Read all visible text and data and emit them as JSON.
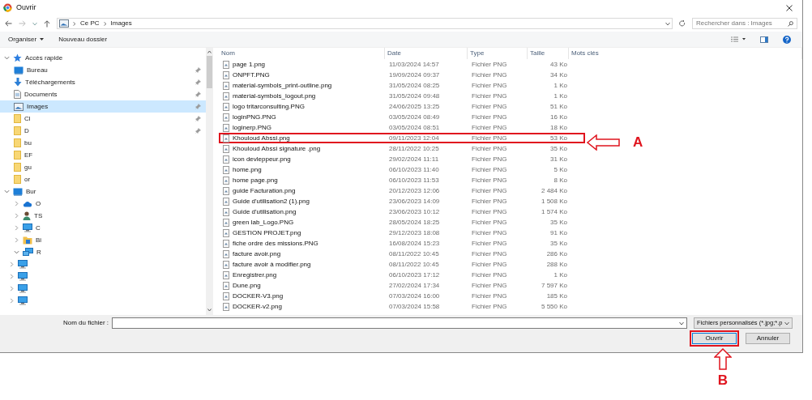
{
  "window": {
    "title": "Ouvrir"
  },
  "address": {
    "path": [
      "Ce PC",
      "Images"
    ],
    "search_placeholder": "Rechercher dans : Images"
  },
  "toolbar": {
    "organize": "Organiser",
    "new_folder": "Nouveau dossier"
  },
  "sidebar": {
    "items": [
      {
        "label": "Accès rapide",
        "kind": "star",
        "expanded": true,
        "selected": false,
        "children": [
          {
            "label": "Bureau",
            "kind": "desktop",
            "pinned": true,
            "selected": false
          },
          {
            "label": "Téléchargements",
            "kind": "download",
            "pinned": true,
            "selected": false
          },
          {
            "label": "Documents",
            "kind": "document",
            "pinned": true,
            "selected": false
          },
          {
            "label": "Images",
            "kind": "pictures",
            "pinned": true,
            "selected": true
          },
          {
            "label": "Cl",
            "kind": "folder",
            "pinned": true,
            "selected": false
          },
          {
            "label": "D",
            "kind": "folder",
            "pinned": true,
            "selected": false
          },
          {
            "label": "bu",
            "kind": "folder",
            "pinned": false,
            "selected": false
          },
          {
            "label": "EF",
            "kind": "folder",
            "pinned": false,
            "selected": false
          },
          {
            "label": "gu",
            "kind": "folder",
            "pinned": false,
            "selected": false
          },
          {
            "label": "or",
            "kind": "folder",
            "pinned": false,
            "selected": false
          }
        ]
      },
      {
        "label": "Bur",
        "kind": "desktop",
        "expanded": true,
        "selected": false,
        "children": [
          {
            "label": "O",
            "kind": "cloud",
            "expanded": false,
            "selected": false
          },
          {
            "label": "TS",
            "kind": "user",
            "expanded": false,
            "selected": false
          },
          {
            "label": "C",
            "kind": "computer",
            "expanded": false,
            "selected": false
          },
          {
            "label": "Bi",
            "kind": "library",
            "expanded": false,
            "selected": false
          },
          {
            "label": "R",
            "kind": "network",
            "expanded": true,
            "selected": false,
            "children": [
              {
                "kind": "computer",
                "expanded": false,
                "selected": false
              },
              {
                "kind": "computer",
                "expanded": false,
                "selected": false
              },
              {
                "kind": "computer",
                "expanded": false,
                "selected": false
              },
              {
                "kind": "computer",
                "expanded": false,
                "selected": false
              }
            ]
          }
        ]
      }
    ]
  },
  "table": {
    "columns": [
      "Nom",
      "Date",
      "Type",
      "Taille",
      "Mots clés"
    ],
    "rows": [
      {
        "name": "page 1.png",
        "date": "11/03/2024 14:57",
        "type": "Fichier PNG",
        "size": "43 Ko",
        "annotated": false
      },
      {
        "name": "ONPFT.PNG",
        "date": "19/09/2024 09:37",
        "type": "Fichier PNG",
        "size": "34 Ko",
        "annotated": false
      },
      {
        "name": "material-symbols_print-outline.png",
        "date": "31/05/2024 08:25",
        "type": "Fichier PNG",
        "size": "1 Ko",
        "annotated": false
      },
      {
        "name": "material-symbols_logout.png",
        "date": "31/05/2024 09:48",
        "type": "Fichier PNG",
        "size": "1 Ko",
        "annotated": false
      },
      {
        "name": "logo tritarconsulting.PNG",
        "date": "24/06/2025 13:25",
        "type": "Fichier PNG",
        "size": "51 Ko",
        "annotated": false
      },
      {
        "name": "loginPNG.PNG",
        "date": "03/05/2024 08:49",
        "type": "Fichier PNG",
        "size": "16 Ko",
        "annotated": false
      },
      {
        "name": "loginerp.PNG",
        "date": "03/05/2024 08:51",
        "type": "Fichier PNG",
        "size": "18 Ko",
        "annotated": false
      },
      {
        "name": "Khouloud Abssi.png",
        "date": "09/11/2023 12:04",
        "type": "Fichier PNG",
        "size": "53 Ko",
        "annotated": true
      },
      {
        "name": "Khouloud Abssi signature .png",
        "date": "28/11/2022 10:25",
        "type": "Fichier PNG",
        "size": "35 Ko",
        "annotated": false
      },
      {
        "name": "icon devleppeur.png",
        "date": "29/02/2024 11:11",
        "type": "Fichier PNG",
        "size": "31 Ko",
        "annotated": false
      },
      {
        "name": "home.png",
        "date": "06/10/2023 11:40",
        "type": "Fichier PNG",
        "size": "5 Ko",
        "annotated": false
      },
      {
        "name": "home page.png",
        "date": "06/10/2023 11:53",
        "type": "Fichier PNG",
        "size": "8 Ko",
        "annotated": false
      },
      {
        "name": "guide Facturation.png",
        "date": "20/12/2023 12:06",
        "type": "Fichier PNG",
        "size": "2 484 Ko",
        "annotated": false
      },
      {
        "name": "Guide d'utilisation2 (1).png",
        "date": "23/06/2023 14:09",
        "type": "Fichier PNG",
        "size": "1 508 Ko",
        "annotated": false
      },
      {
        "name": "Guide d'utilisation.png",
        "date": "23/06/2023 10:12",
        "type": "Fichier PNG",
        "size": "1 574 Ko",
        "annotated": false
      },
      {
        "name": "green lab_Logo.PNG",
        "date": "28/05/2024 18:25",
        "type": "Fichier PNG",
        "size": "35 Ko",
        "annotated": false
      },
      {
        "name": "GESTION PROJET.png",
        "date": "29/12/2023 18:08",
        "type": "Fichier PNG",
        "size": "91 Ko",
        "annotated": false
      },
      {
        "name": "fiche ordre des missions.PNG",
        "date": "16/08/2024 15:23",
        "type": "Fichier PNG",
        "size": "35 Ko",
        "annotated": false
      },
      {
        "name": "facture avoir.png",
        "date": "08/11/2022 10:45",
        "type": "Fichier PNG",
        "size": "286 Ko",
        "annotated": false
      },
      {
        "name": "facture avoir à modifier.png",
        "date": "08/11/2022 10:45",
        "type": "Fichier PNG",
        "size": "288 Ko",
        "annotated": false
      },
      {
        "name": "Enregistrer.png",
        "date": "06/10/2023 17:12",
        "type": "Fichier PNG",
        "size": "1 Ko",
        "annotated": false
      },
      {
        "name": "Dune.png",
        "date": "27/02/2024 17:34",
        "type": "Fichier PNG",
        "size": "7 597 Ko",
        "annotated": false
      },
      {
        "name": "DOCKER-V3.png",
        "date": "07/03/2024 16:00",
        "type": "Fichier PNG",
        "size": "185 Ko",
        "annotated": false
      },
      {
        "name": "DOCKER-v2.png",
        "date": "07/03/2024 15:58",
        "type": "Fichier PNG",
        "size": "5 550 Ko",
        "annotated": false
      }
    ]
  },
  "footer": {
    "filename_label": "Nom du fichier :",
    "filetype": "Fichiers personnalisés (*.jpg;*.p",
    "buttons": [
      {
        "label": "Ouvrir",
        "kind": "primary",
        "annotated": true
      },
      {
        "label": "Annuler",
        "kind": "secondary",
        "annotated": false
      }
    ]
  },
  "annotations": [
    {
      "label": "A",
      "kind": "left-arrow"
    },
    {
      "label": "B",
      "kind": "up-arrow"
    }
  ]
}
